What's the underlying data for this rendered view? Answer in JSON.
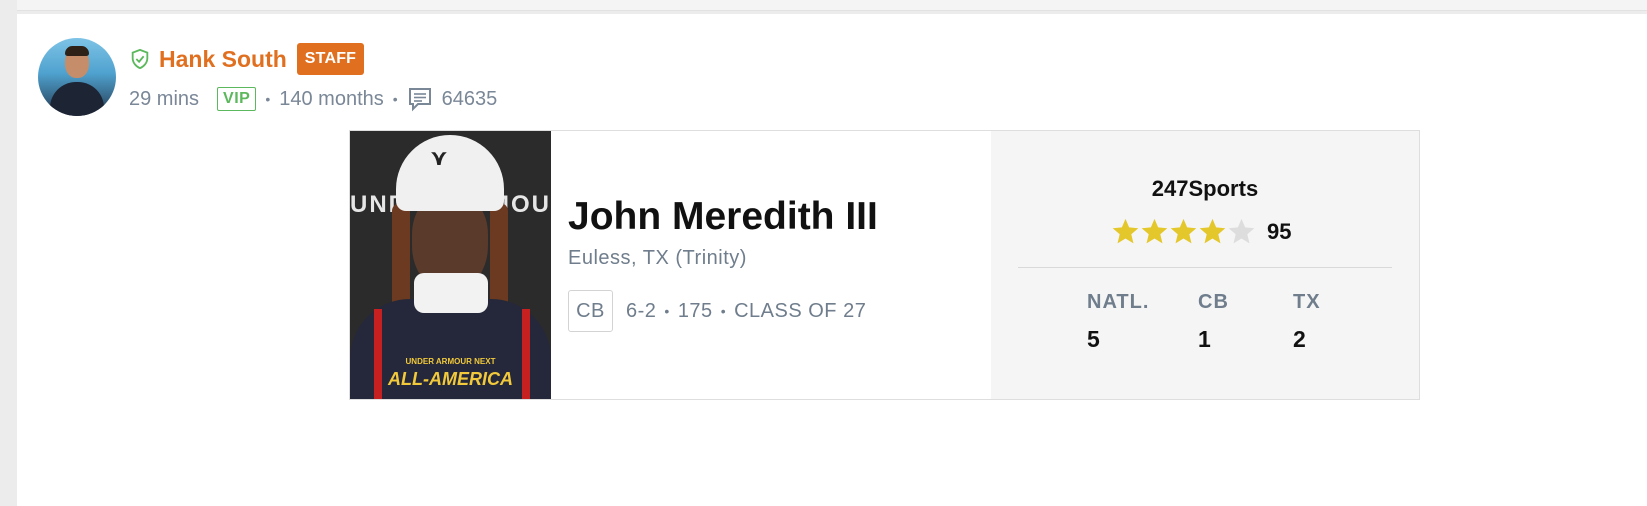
{
  "post": {
    "author_name": "Hank South",
    "staff_badge": "STAFF",
    "time_ago": "29 mins",
    "vip_badge": "VIP",
    "tenure": "140 months",
    "comment_count": "64635"
  },
  "player": {
    "name": "John Meredith III",
    "hometown": "Euless, TX (Trinity)",
    "position": "CB",
    "height": "6-2",
    "weight": "175",
    "class": "CLASS OF 27",
    "photo_text": {
      "banner_left": "UND",
      "banner_right": "MOU",
      "shirt_small": "UNDER ARMOUR NEXT",
      "shirt_big": "ALL-AMERICA"
    }
  },
  "rating": {
    "source": "247Sports",
    "stars": 4,
    "max_stars": 5,
    "score": "95",
    "ranks": [
      {
        "label": "NATL.",
        "value": "5"
      },
      {
        "label": "CB",
        "value": "1"
      },
      {
        "label": "TX",
        "value": "2"
      }
    ]
  },
  "colors": {
    "accent_orange": "#e07020",
    "vip_green": "#5cb85c",
    "star_gold": "#e4c72a",
    "star_empty": "#dddddd"
  },
  "icons": {
    "verified": "shield-check-icon",
    "comments": "comment-icon",
    "stars": "star-icon"
  }
}
